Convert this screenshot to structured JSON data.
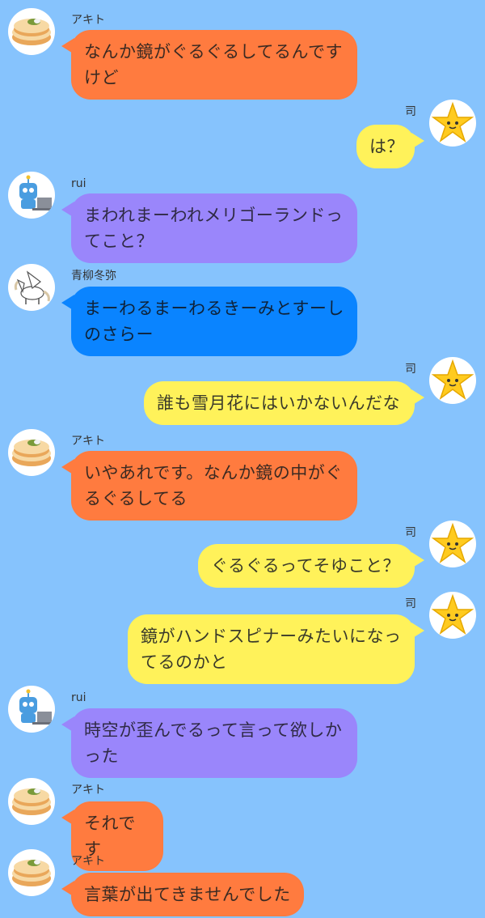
{
  "colors": {
    "background": "#86c3fd",
    "akito": "#ff7b3f",
    "tsukasa": "#fff25a",
    "rui": "#9a86fb",
    "toya": "#0a84ff"
  },
  "messages": [
    {
      "sender": "アキト",
      "side": "left",
      "avatar": "pancake-icon",
      "color": "akito",
      "text": "なんか鏡がぐるぐるしてるんですけど"
    },
    {
      "sender": "司",
      "side": "right",
      "avatar": "star-icon",
      "color": "tsukasa",
      "text": "は？"
    },
    {
      "sender": "rui",
      "side": "left",
      "avatar": "robot-icon",
      "color": "rui",
      "text": "まわれまーわれメリゴーランドってこと？"
    },
    {
      "sender": "青柳冬弥",
      "side": "left",
      "avatar": "pegasus-icon",
      "color": "toya",
      "text": "まーわるまーわるきーみとすーしのさらー"
    },
    {
      "sender": "司",
      "side": "right",
      "avatar": "star-icon",
      "color": "tsukasa",
      "text": "誰も雪月花にはいかないんだな"
    },
    {
      "sender": "アキト",
      "side": "left",
      "avatar": "pancake-icon",
      "color": "akito",
      "text": "いやあれです。なんか鏡の中がぐるぐるしてる"
    },
    {
      "sender": "司",
      "side": "right",
      "avatar": "star-icon",
      "color": "tsukasa",
      "text": "ぐるぐるってそゆこと？"
    },
    {
      "sender": "司",
      "side": "right",
      "avatar": "star-icon",
      "color": "tsukasa",
      "text": "鏡がハンドスピナーみたいになってるのかと"
    },
    {
      "sender": "rui",
      "side": "left",
      "avatar": "robot-icon",
      "color": "rui",
      "text": "時空が歪んでるって言って欲しかった"
    },
    {
      "sender": "アキト",
      "side": "left",
      "avatar": "pancake-icon",
      "color": "akito",
      "text": "それです"
    },
    {
      "sender": "アキト",
      "side": "left",
      "avatar": "pancake-icon",
      "color": "akito",
      "text": "言葉が出てきませんでした"
    }
  ]
}
